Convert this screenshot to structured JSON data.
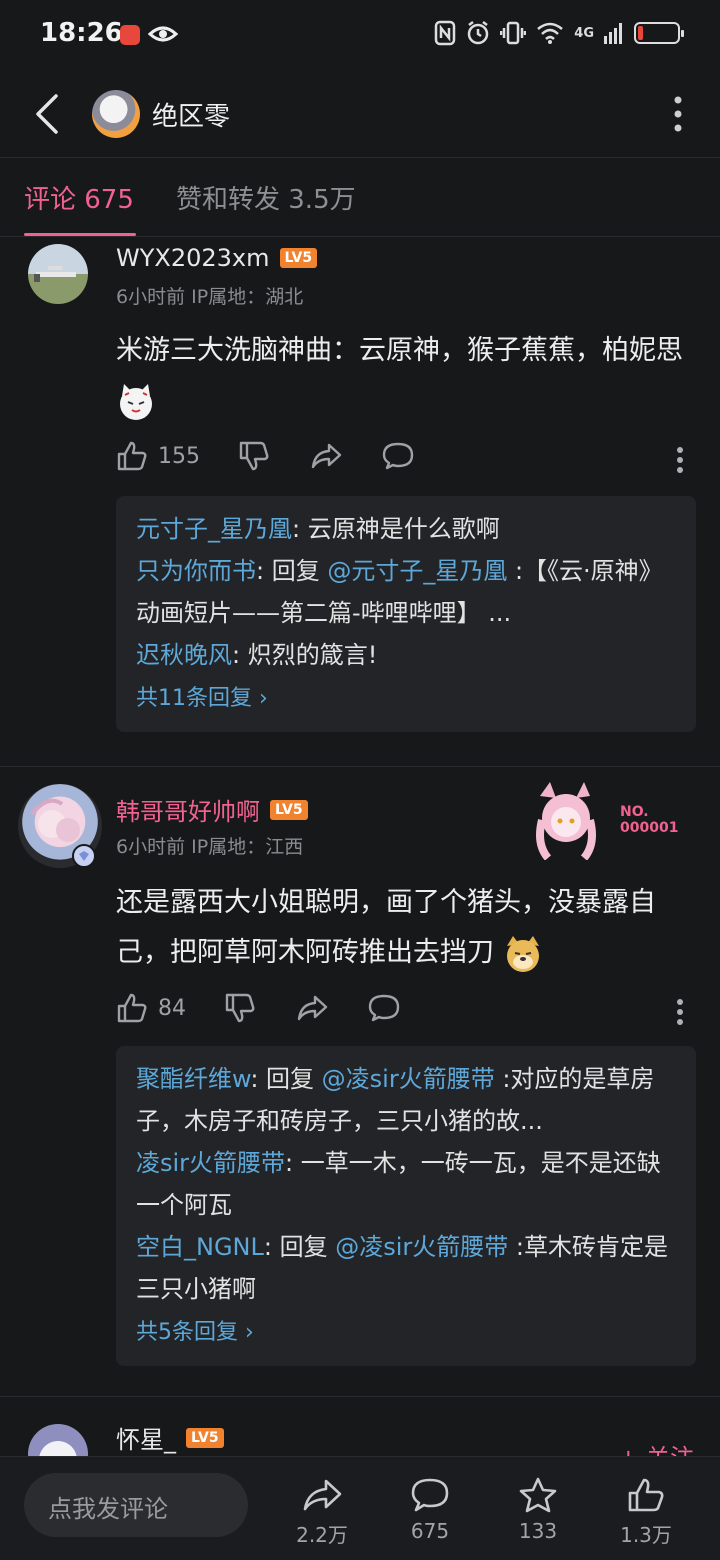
{
  "status": {
    "time": "18:26",
    "network": "4G"
  },
  "header": {
    "title": "绝区零"
  },
  "tabs": {
    "active": "评论 675",
    "inactive": "赞和转发 3.5万"
  },
  "comments": [
    {
      "username": "WYX2023xm",
      "level": "LV5",
      "meta": "6小时前  IP属地：湖北",
      "text": "米游三大洗脑神曲：云原神，猴子蕉蕉，柏妮思",
      "likes": "155",
      "replies": [
        {
          "user": "元寸子_星乃凰",
          "sep": ": ",
          "text": "云原神是什么歌啊"
        },
        {
          "user": "只为你而书",
          "sep": ": 回复 ",
          "at": "@元寸子_星乃凰",
          "text": " :【《云·原神》动画短片——第二篇-哔哩哔哩】 ..."
        },
        {
          "user": "迟秋晚风",
          "sep": ": ",
          "text": "炽烈的箴言!"
        }
      ],
      "more": "共11条回复 ›"
    },
    {
      "username": "韩哥哥好帅啊",
      "level": "LV5",
      "meta": "6小时前  IP属地：江西",
      "badge_text": "NO.",
      "badge_num": "000001",
      "text": "还是露西大小姐聪明，画了个猪头，没暴露自己，把阿草阿木阿砖推出去挡刀",
      "likes": "84",
      "replies": [
        {
          "user": "聚酯纤维w",
          "sep": ": 回复 ",
          "at": "@凌sir火箭腰带",
          "text": " :对应的是草房子，木房子和砖房子，三只小猪的故..."
        },
        {
          "user": "凌sir火箭腰带",
          "sep": ": ",
          "text": "一草一木，一砖一瓦，是不是还缺一个阿瓦"
        },
        {
          "user": "空白_NGNL",
          "sep": ": 回复 ",
          "at": "@凌sir火箭腰带",
          "text": " :草木砖肯定是三只小猪啊"
        }
      ],
      "more": "共5条回复 ›"
    },
    {
      "username": "怀星_",
      "level": "LV5",
      "follow": "+ 关注"
    }
  ],
  "bottom": {
    "input_placeholder": "点我发评论",
    "share_count": "2.2万",
    "comment_count": "675",
    "star_count": "133",
    "like_count": "1.3万"
  },
  "colors": {
    "accent": "#f0628f",
    "link": "#5da8d8",
    "level": "#f2832e",
    "background": "#17181a"
  }
}
